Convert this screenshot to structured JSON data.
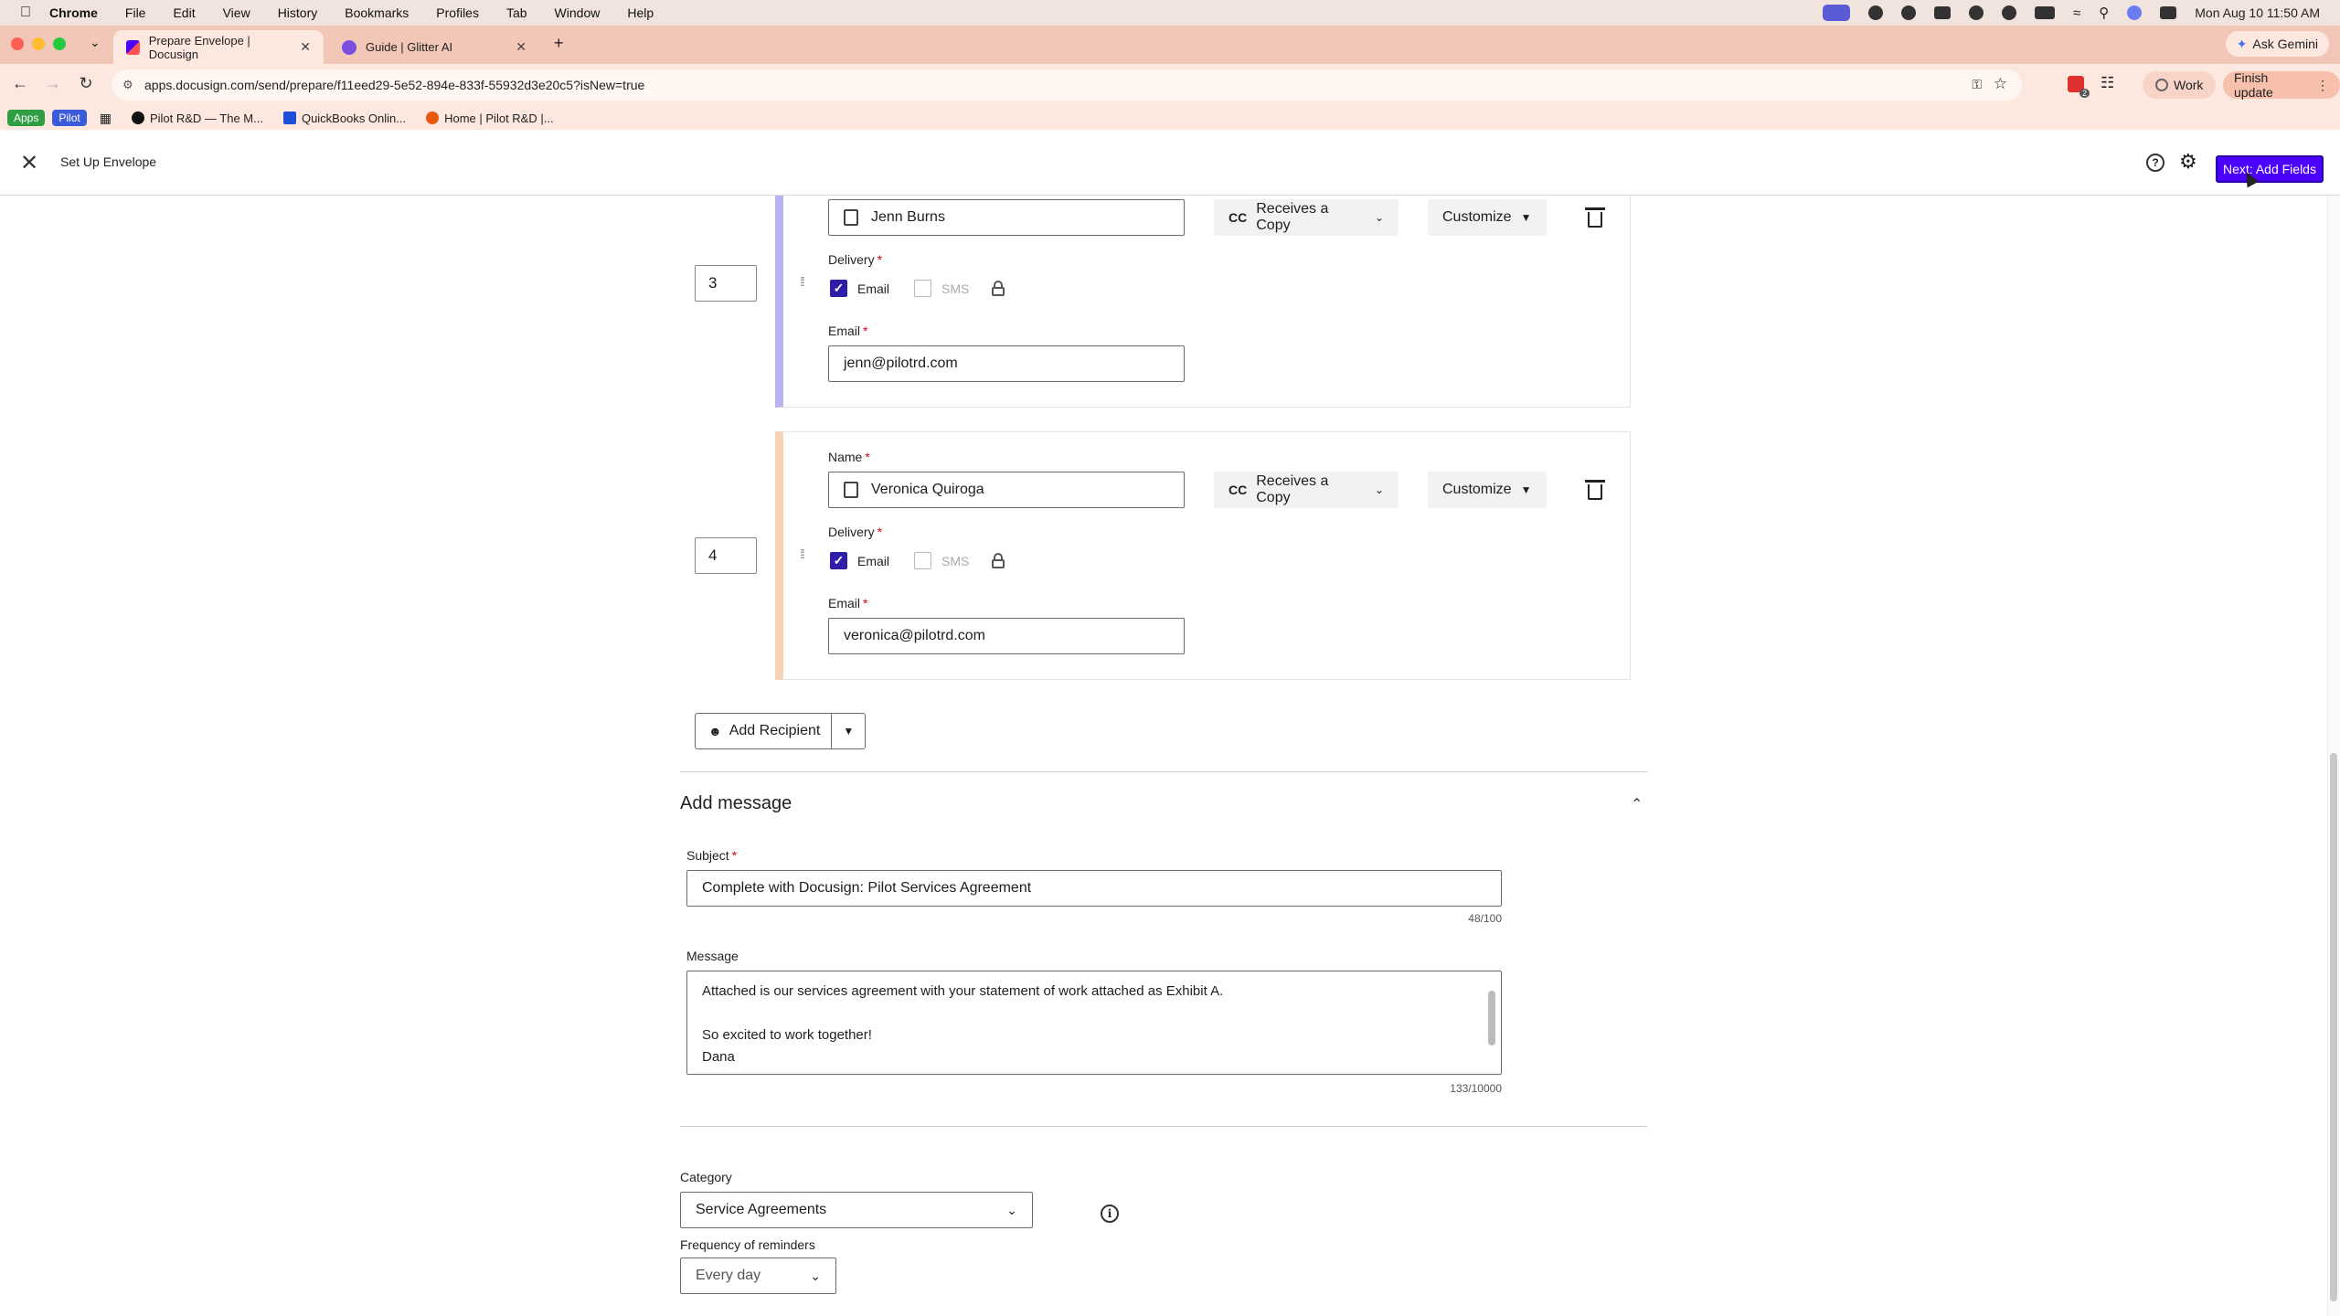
{
  "menubar": {
    "app": "Chrome",
    "items": [
      "File",
      "Edit",
      "View",
      "History",
      "Bookmarks",
      "Profiles",
      "Tab",
      "Window",
      "Help"
    ],
    "datetime": "Mon Aug 10  11:50 AM"
  },
  "tabs": [
    {
      "title": "Prepare Envelope | Docusign"
    },
    {
      "title": "Guide | Glitter AI"
    }
  ],
  "ask_gemini": "Ask Gemini",
  "toolbar": {
    "url": "apps.docusign.com/send/prepare/f11eed29-5e52-894e-833f-55932d3e20c5?isNew=true",
    "profile": "Work",
    "finish_update": "Finish update",
    "badge_count": "2"
  },
  "bookmarks": {
    "apps": "Apps",
    "pilot": "Pilot",
    "items": [
      "Pilot R&D — The M...",
      "QuickBooks Onlin...",
      "Home | Pilot R&D |..."
    ]
  },
  "header": {
    "title": "Set Up Envelope",
    "next_button": "Next: Add Fields"
  },
  "recipients": [
    {
      "order": "3",
      "name": "Jenn Burns",
      "role": "Receives a Copy",
      "role_abbr": "CC",
      "customize": "Customize",
      "delivery_label": "Delivery",
      "email_option": "Email",
      "sms_option": "SMS",
      "email_label": "Email",
      "email": "jenn@pilotrd.com",
      "accent": "#b8b2f0"
    },
    {
      "order": "4",
      "name_label": "Name",
      "name": "Veronica Quiroga",
      "role": "Receives a Copy",
      "role_abbr": "CC",
      "customize": "Customize",
      "delivery_label": "Delivery",
      "email_option": "Email",
      "sms_option": "SMS",
      "email_label": "Email",
      "email": "veronica@pilotrd.com",
      "accent": "#f7d3b4"
    }
  ],
  "add_recipient": "Add Recipient",
  "message": {
    "section_title": "Add message",
    "subject_label": "Subject",
    "subject": "Complete with Docusign: Pilot Services Agreement",
    "subject_count": "48/100",
    "message_label": "Message",
    "message": "Attached is our services agreement with your statement of work attached as Exhibit A.\n\nSo excited to work together!\nDana",
    "message_count": "133/10000"
  },
  "category": {
    "label": "Category",
    "value": "Service Agreements"
  },
  "reminders": {
    "label": "Frequency of reminders",
    "value": "Every day"
  }
}
